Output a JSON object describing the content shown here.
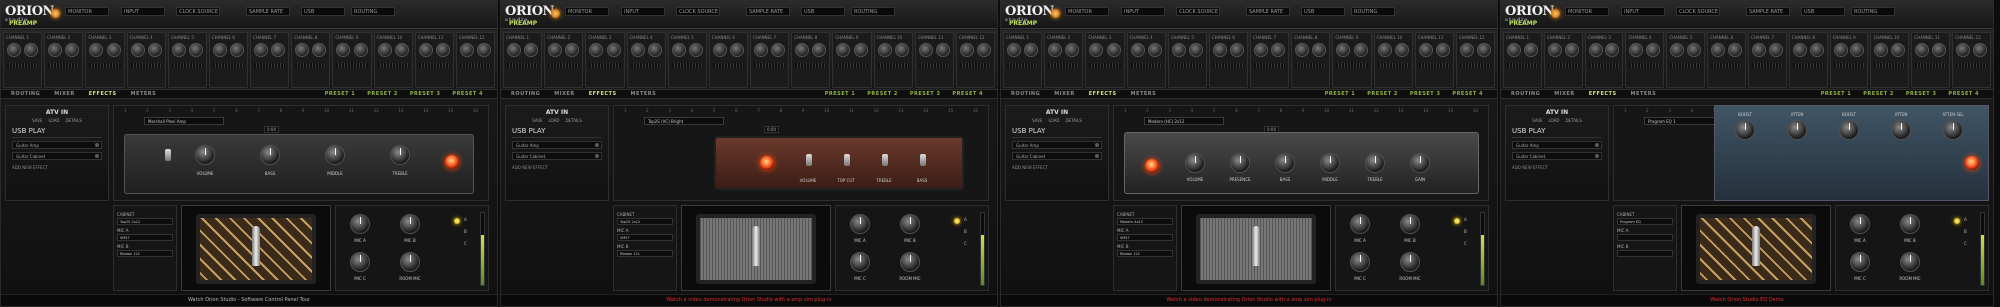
{
  "app": {
    "logo": "ORION",
    "logo_sub": "studio",
    "preamp_tab": "PREAMP",
    "footer_label": "Watch Orion Studio - Software Control Panel Tour"
  },
  "panels": [
    {
      "label": "Watch Orion Studio - Software Control Panel Tour",
      "red": false,
      "device_preset": "Marshall Plexi Amp",
      "time": "0:00",
      "cabinet": "Top2S 2x12",
      "mic_a": "SM57",
      "mic_b": "Ribbon 121",
      "mic_c": "Room Mic"
    },
    {
      "label": "Watch a video demonstrating Orion Studio with a amp sim plug-in",
      "red": true,
      "device_preset": "Top2S (VC) Bright",
      "time": "0:00",
      "cabinet": "Top2S 2x12",
      "mic_a": "SM57",
      "mic_b": "Ribbon 121",
      "mic_c": "Room Mic"
    },
    {
      "label": "Watch a video demonstrating Orion Studio with a amp sim plug-in",
      "red": true,
      "device_preset": "Modern (HC) 2x12",
      "time": "0:00",
      "cabinet": "Modern 4x12",
      "mic_a": "SM57",
      "mic_b": "Ribbon 121",
      "mic_c": "Room Mic"
    },
    {
      "label": "Watch Orion Studio EQ Demo",
      "red": true,
      "device_preset": "Program EQ 1",
      "time": "0:00",
      "cabinet": "Program EQ",
      "mic_a": "",
      "mic_b": "",
      "mic_c": ""
    }
  ],
  "nav": {
    "tabs": [
      "ROUTING",
      "MIXER",
      "EFFECTS",
      "METERS"
    ],
    "active": "EFFECTS",
    "right": [
      "PRESET",
      "PRESET",
      "PRESET",
      "PRESET"
    ]
  },
  "sidebar": {
    "title": "ATV IN",
    "btns": [
      "SAVE",
      "LOAD",
      "DETAILS"
    ],
    "usb": "USB PLAY",
    "slots": [
      "Guitar Amp",
      "Guitar Cabinet"
    ],
    "add": "ADD NEW EFFECT"
  },
  "amp_knobs": [
    "VOLUME",
    "BASS",
    "MIDDLE",
    "TREBLE"
  ],
  "channels": [
    "CHANNEL 1",
    "CHANNEL 2",
    "CHANNEL 3",
    "CHANNEL 4",
    "CHANNEL 5",
    "CHANNEL 6",
    "CHANNEL 7",
    "CHANNEL 8",
    "CHANNEL 9",
    "CHANNEL 10",
    "CHANNEL 11",
    "CHANNEL 12"
  ],
  "colors": {
    "accent": "#cfe97a",
    "led": "#ff5522",
    "footer_red": "#e03030"
  }
}
